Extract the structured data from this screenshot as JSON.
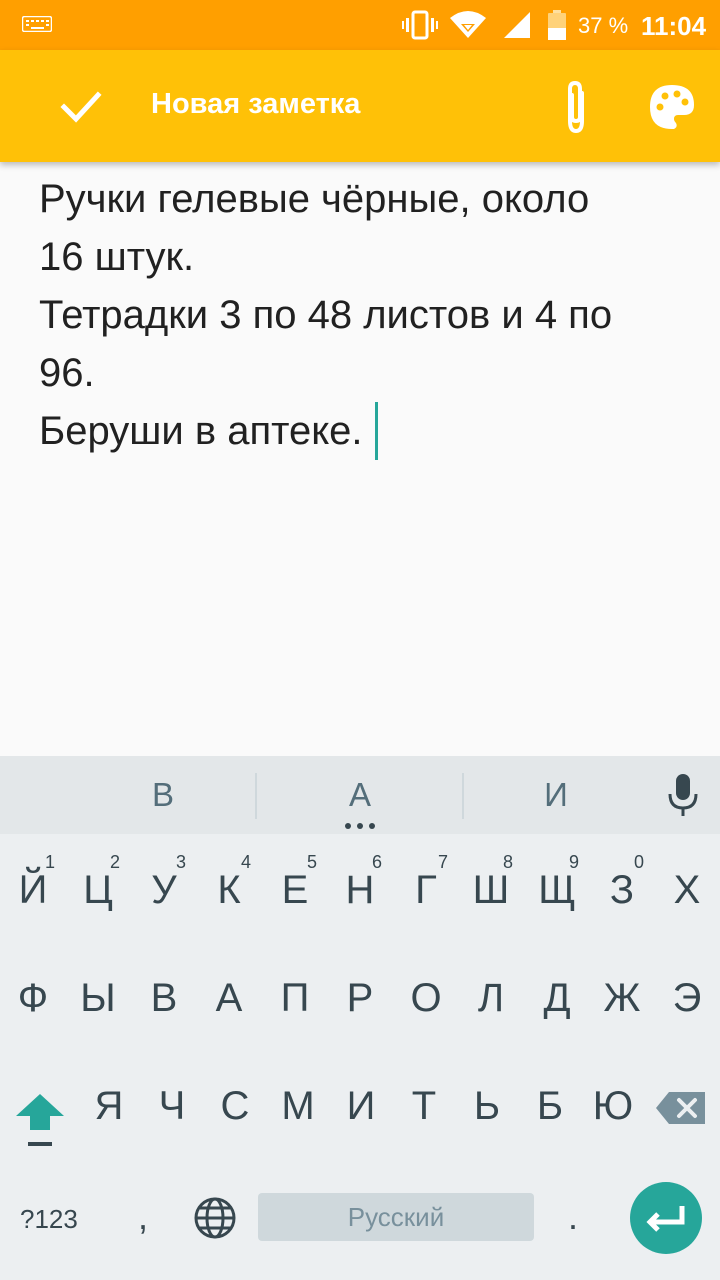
{
  "status_bar": {
    "battery_percent": "37 %",
    "time": "11:04",
    "icons": [
      "keyboard-icon",
      "vibrate-icon",
      "wifi-icon",
      "signal-icon",
      "battery-icon"
    ]
  },
  "toolbar": {
    "title": "Новая заметка",
    "icons": [
      "check-icon",
      "paperclip-icon",
      "palette-icon"
    ]
  },
  "note": {
    "lines": [
      "Ручки гелевые чёрные, около",
      "16 штук.",
      "Тетрадки 3 по 48 листов и 4 по",
      "96.",
      "Беруши в аптеке."
    ]
  },
  "keyboard": {
    "suggestions": [
      "В",
      "А",
      "И"
    ],
    "row1": [
      {
        "key": "Й",
        "hint": "1"
      },
      {
        "key": "Ц",
        "hint": "2"
      },
      {
        "key": "У",
        "hint": "3"
      },
      {
        "key": "К",
        "hint": "4"
      },
      {
        "key": "Е",
        "hint": "5"
      },
      {
        "key": "Н",
        "hint": "6"
      },
      {
        "key": "Г",
        "hint": "7"
      },
      {
        "key": "Ш",
        "hint": "8"
      },
      {
        "key": "Щ",
        "hint": "9"
      },
      {
        "key": "З",
        "hint": "0"
      },
      {
        "key": "Х",
        "hint": ""
      }
    ],
    "row2": [
      "Ф",
      "Ы",
      "В",
      "А",
      "П",
      "Р",
      "О",
      "Л",
      "Д",
      "Ж",
      "Э"
    ],
    "row3": [
      "Я",
      "Ч",
      "С",
      "М",
      "И",
      "Т",
      "Ь",
      "Б",
      "Ю"
    ],
    "symbols_label": "?123",
    "comma": ",",
    "space_label": "Русский",
    "period": ".",
    "accent_color": "#26a69a"
  },
  "colors": {
    "status_bar": "#ff9f00",
    "toolbar": "#ffc107",
    "caret": "#26a69a"
  }
}
